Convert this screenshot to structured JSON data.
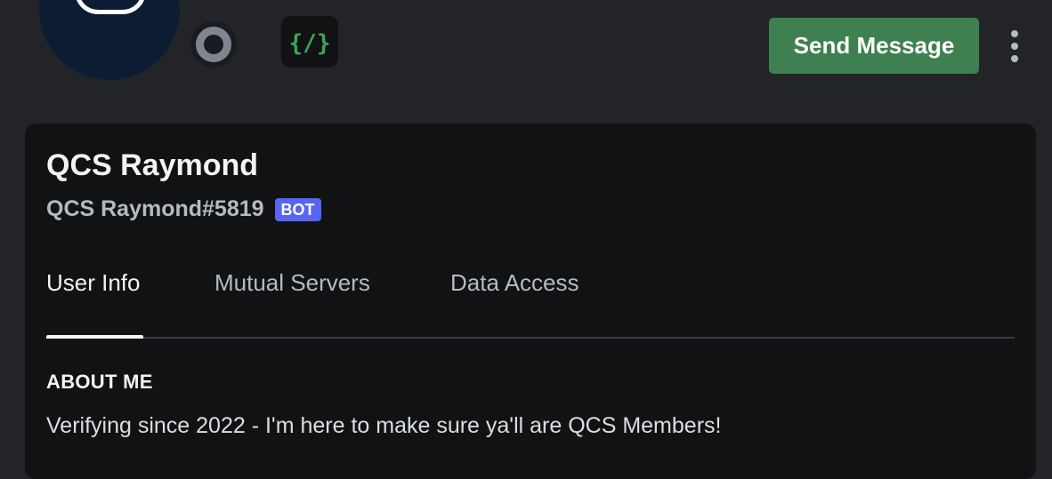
{
  "profile": {
    "display_name": "QCS Raymond",
    "username": "QCS Raymond#5819",
    "bot_tag": "BOT",
    "status": "offline"
  },
  "badge": {
    "glyph": "{/}",
    "icon": "slash-commands-icon",
    "color": "#3ba55c"
  },
  "actions": {
    "send_message_label": "Send Message",
    "more_icon": "more-vertical-icon"
  },
  "tabs": [
    {
      "label": "User Info",
      "active": true
    },
    {
      "label": "Mutual Servers",
      "active": false
    },
    {
      "label": "Data Access",
      "active": false
    }
  ],
  "about": {
    "heading": "ABOUT ME",
    "text": "Verifying since 2022 - I'm here to make sure ya'll are QCS Members!"
  },
  "colors": {
    "background": "#232428",
    "card": "#111214",
    "send_button": "#3e8050",
    "bot_tag": "#5865f2",
    "status_offline": "#80848e"
  }
}
